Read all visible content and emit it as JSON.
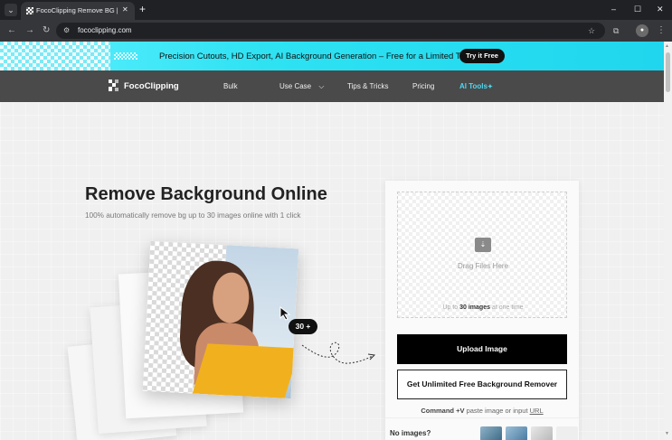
{
  "browser": {
    "tab_title": "FocoClipping Remove BG | Fre",
    "tab_close": "✕",
    "new_tab": "+",
    "url": "fococlipping.com",
    "window_controls": [
      "–",
      "☐",
      "✕"
    ],
    "nav_icons": [
      "back-arrow-icon",
      "forward-arrow-icon",
      "reload-icon"
    ]
  },
  "banner": {
    "text": "Precision Cutouts, HD Export, AI Background Generation – Free for a Limited Time",
    "cta": "Try it Free"
  },
  "nav": {
    "logo": "FocoClipping",
    "links": [
      "Bulk",
      "Use Case",
      "Tips & Tricks",
      "Pricing"
    ],
    "use_case_caret": "⌵",
    "ai_tools": "AI Tools"
  },
  "hero": {
    "title": "Remove Background Online",
    "subtitle": "100% automatically remove bg up to 30 images online with 1 click",
    "badge": "30 +"
  },
  "upload": {
    "drop_label": "Drag Files Here",
    "limit_prefix": "Up to ",
    "limit_bold": "30 images",
    "limit_suffix": " at one time",
    "upload_button": "Upload Image",
    "unlimited_button": "Get Unlimited Free Background Remover",
    "paste_key": "Command +V",
    "paste_text": " paste image or input ",
    "paste_link": "URL",
    "no_images": "No images?"
  },
  "colors": {
    "banner": "#2ee2f2",
    "nav": "#4a4a4a",
    "accent": "#4fd8f2",
    "primary_button": "#000000"
  }
}
